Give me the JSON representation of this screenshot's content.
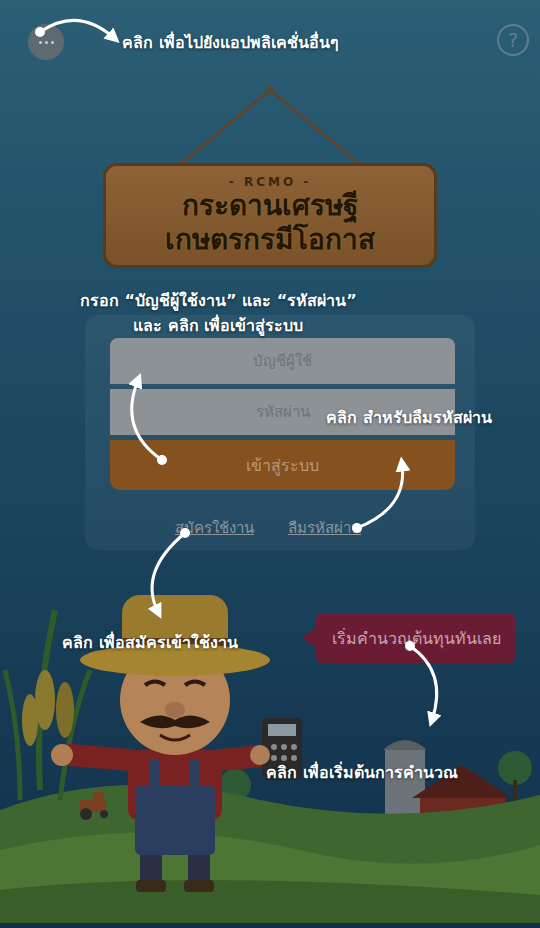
{
  "top_bar": {
    "help_button": "?"
  },
  "sign": {
    "brand": "- RCMO -",
    "title_lines": [
      "กระดานเศรษฐี",
      "เกษตรกรมีโอกาส"
    ]
  },
  "login_form": {
    "username_placeholder": "บัญชีผู้ใช้",
    "password_placeholder": "รหัสผ่าน",
    "submit": "เข้าสู่ระบบ",
    "register_link": "สมัครใช้งาน",
    "forgot_link": "ลืมรหัสผ่าน"
  },
  "start_button": "เริ่มคำนวณต้นทุนทันเลย",
  "tutorial_notes": [
    {
      "lines": [
        "คลิก เพื่อไปยังแอปพลิเคชั่นอื่นๆ"
      ]
    },
    {
      "lines": [
        "กรอก “บัญชีผู้ใช้งาน” และ “รหัสผ่าน”",
        "และ คลิก เพื่อเข้าสู่ระบบ"
      ]
    },
    {
      "lines": [
        "คลิก สำหรับลืมรหัสผ่าน"
      ]
    },
    {
      "lines": [
        "คลิก เพื่อสมัครเข้าใช้งาน"
      ]
    },
    {
      "lines": [
        "คลิก เพื่อเริ่มต้นการคำนวณ"
      ]
    }
  ]
}
